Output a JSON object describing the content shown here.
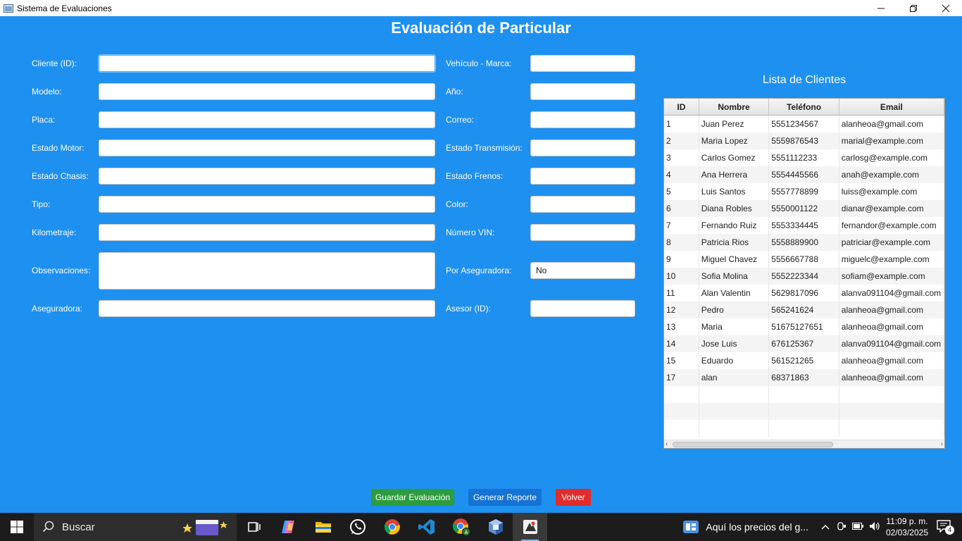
{
  "window": {
    "title": "Sistema de Evaluaciones",
    "minimize": "—",
    "restore": "❐",
    "close": "✕"
  },
  "page": {
    "title": "Evaluación de Particular"
  },
  "form": {
    "cliente_id": {
      "label": "Cliente (ID):",
      "value": ""
    },
    "modelo": {
      "label": "Modelo:",
      "value": ""
    },
    "placa": {
      "label": "Placa:",
      "value": ""
    },
    "estado_motor": {
      "label": "Estado Motor:",
      "value": ""
    },
    "estado_chasis": {
      "label": "Estado Chasis:",
      "value": ""
    },
    "tipo": {
      "label": "Tipo:",
      "value": ""
    },
    "kilometraje": {
      "label": "Kilometraje:",
      "value": ""
    },
    "observaciones": {
      "label": "Observaciones:",
      "value": ""
    },
    "aseguradora": {
      "label": "Aseguradora:",
      "value": ""
    },
    "vehiculo_marca": {
      "label": "Vehículo - Marca:",
      "value": ""
    },
    "anio": {
      "label": "Año:",
      "value": ""
    },
    "correo": {
      "label": "Correo:",
      "value": ""
    },
    "estado_transmision": {
      "label": "Estado Transmisión:",
      "value": ""
    },
    "estado_frenos": {
      "label": "Estado Frenos:",
      "value": ""
    },
    "color": {
      "label": "Color:",
      "value": ""
    },
    "numero_vin": {
      "label": "Número VIN:",
      "value": ""
    },
    "por_aseguradora": {
      "label": "Por Aseguradora:",
      "value": "No"
    },
    "asesor_id": {
      "label": "Asesor (ID):",
      "value": ""
    }
  },
  "clientes": {
    "title": "Lista de Clientes",
    "columns": [
      "ID",
      "Nombre",
      "Teléfono",
      "Email"
    ],
    "rows": [
      [
        "1",
        "Juan Perez",
        "5551234567",
        "alanheoa@gmail.com"
      ],
      [
        "2",
        "Maria Lopez",
        "5559876543",
        "marial@example.com"
      ],
      [
        "3",
        "Carlos Gomez",
        "5551112233",
        "carlosg@example.com"
      ],
      [
        "4",
        "Ana Herrera",
        "5554445566",
        "anah@example.com"
      ],
      [
        "5",
        "Luis Santos",
        "5557778899",
        "luiss@example.com"
      ],
      [
        "6",
        "Diana Robles",
        "5550001122",
        "dianar@example.com"
      ],
      [
        "7",
        "Fernando Ruiz",
        "5553334445",
        "fernandor@example.com"
      ],
      [
        "8",
        "Patricia Rios",
        "5558889900",
        "patriciar@example.com"
      ],
      [
        "9",
        "Miguel Chavez",
        "5556667788",
        "miguelc@example.com"
      ],
      [
        "10",
        "Sofia Molina",
        "5552223344",
        "sofiam@example.com"
      ],
      [
        "11",
        "Alan Valentin",
        "5629817096",
        "alanva091104@gmail.com"
      ],
      [
        "12",
        "Pedro",
        "565241624",
        "alanheoa@gmail.com"
      ],
      [
        "13",
        "Maria",
        "51675127651",
        "alanheoa@gmail.com"
      ],
      [
        "14",
        "Jose Luis",
        "676125367",
        "alanva091104@gmail.com"
      ],
      [
        "15",
        "Eduardo",
        "561521265",
        "alanheoa@gmail.com"
      ],
      [
        "17",
        "alan",
        "68371863",
        "alanheoa@gmail.com"
      ]
    ]
  },
  "buttons": {
    "guardar": "Guardar Evaluación",
    "generar": "Generar Reporte",
    "volver": "Volver"
  },
  "taskbar": {
    "search_placeholder": "Buscar",
    "news": "Aquí los precios del g...",
    "time": "11:09 p. m.",
    "date": "02/03/2025",
    "notifications": "4",
    "icons": [
      "task-view-icon",
      "copilot-icon",
      "file-explorer-icon",
      "whatsapp-icon",
      "chrome-icon",
      "vscode-icon",
      "chrome-profile-icon",
      "virtualbox-icon",
      "java-app-icon"
    ]
  }
}
